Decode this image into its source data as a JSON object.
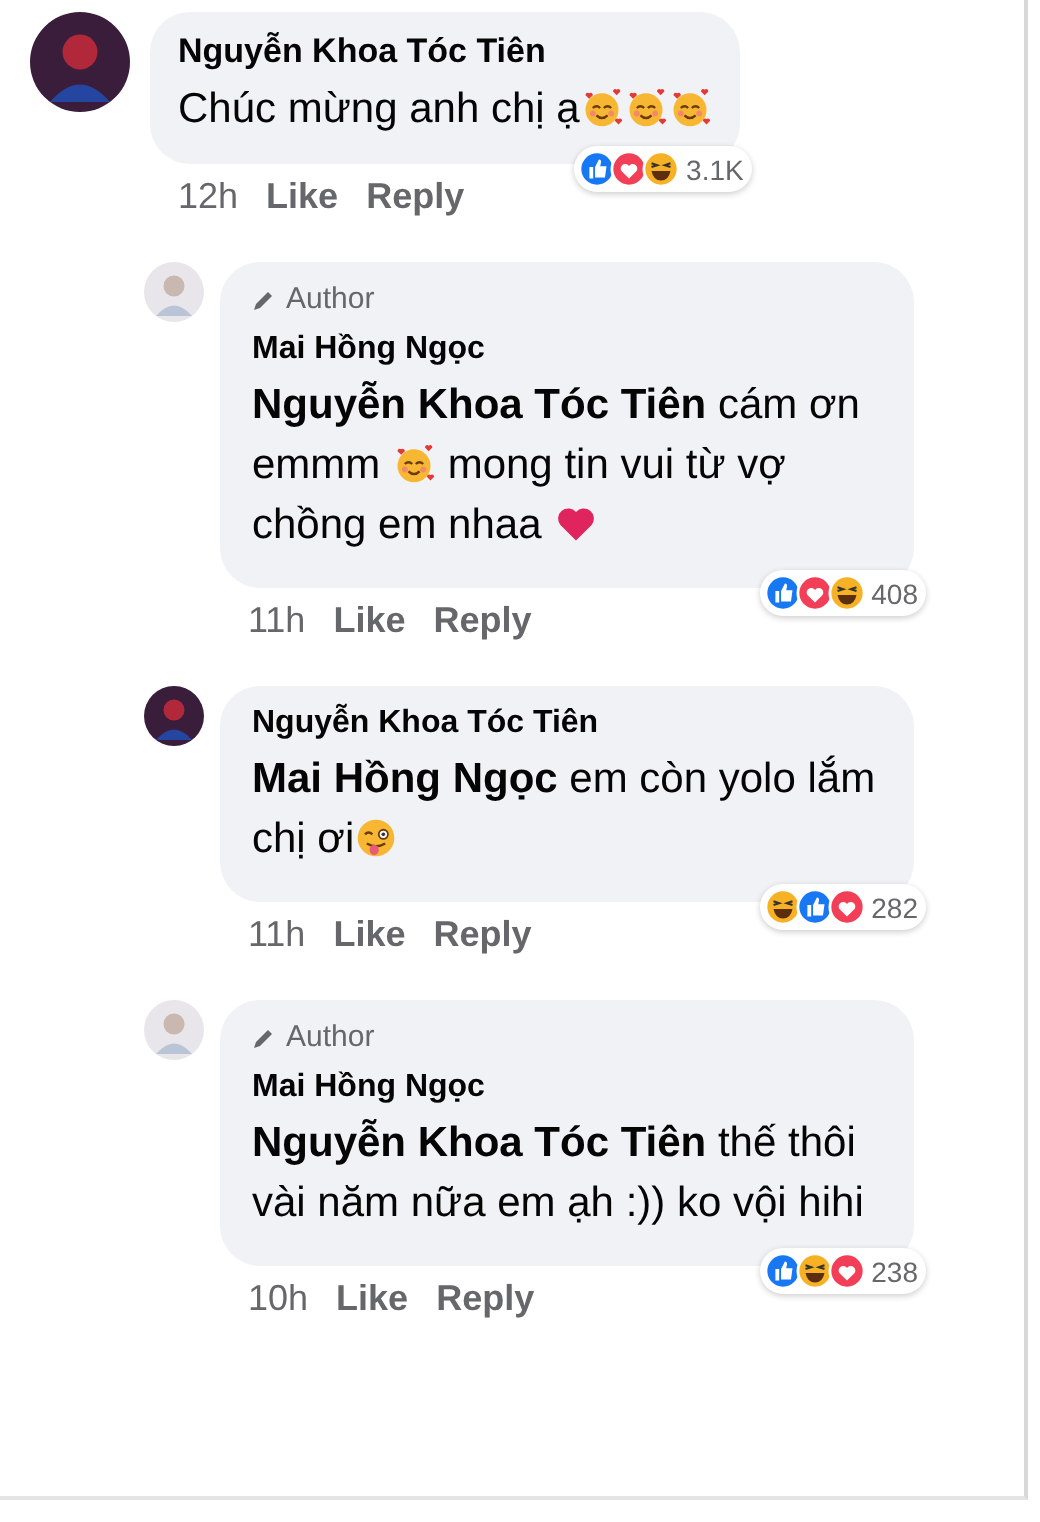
{
  "comments": [
    {
      "author": "Nguyễn Khoa Tóc Tiên",
      "reply": false,
      "is_author": false,
      "body": [
        {
          "kind": "text",
          "text": "Chúc mừng anh chị ạ"
        },
        {
          "kind": "hearts"
        },
        {
          "kind": "hearts"
        },
        {
          "kind": "hearts"
        }
      ],
      "time": "12h",
      "like": "Like",
      "reply_label": "Reply",
      "reactions": [
        {
          "kind": "like"
        },
        {
          "kind": "love"
        },
        {
          "kind": "haha"
        }
      ],
      "reaction_count": "3.1K"
    },
    {
      "author": "Mai Hồng Ngọc",
      "reply": true,
      "is_author": true,
      "author_badge": "Author",
      "body": [
        {
          "kind": "mention",
          "text": "Nguyễn Khoa Tóc Tiên"
        },
        {
          "kind": "text",
          "text": " cám ơn emmm "
        },
        {
          "kind": "hearts"
        },
        {
          "kind": "text",
          "text": " mong tin vui từ vợ chồng em nhaa "
        },
        {
          "kind": "heart"
        }
      ],
      "time": "11h",
      "like": "Like",
      "reply_label": "Reply",
      "reactions": [
        {
          "kind": "like"
        },
        {
          "kind": "love"
        },
        {
          "kind": "haha"
        }
      ],
      "reaction_count": "408"
    },
    {
      "author": "Nguyễn Khoa Tóc Tiên",
      "reply": true,
      "is_author": false,
      "body": [
        {
          "kind": "mention",
          "text": "Mai Hồng Ngọc"
        },
        {
          "kind": "text",
          "text": "  em còn yolo lắm chị ơi"
        },
        {
          "kind": "wink"
        }
      ],
      "time": "11h",
      "like": "Like",
      "reply_label": "Reply",
      "reactions": [
        {
          "kind": "haha"
        },
        {
          "kind": "like"
        },
        {
          "kind": "love"
        }
      ],
      "reaction_count": "282"
    },
    {
      "author": "Mai Hồng Ngọc",
      "reply": true,
      "is_author": true,
      "author_badge": "Author",
      "body": [
        {
          "kind": "mention",
          "text": "Nguyễn Khoa Tóc Tiên"
        },
        {
          "kind": "text",
          "text": " thế thôi vài năm nữa em ạh :)) ko vội hihi"
        }
      ],
      "time": "10h",
      "like": "Like",
      "reply_label": "Reply",
      "reactions": [
        {
          "kind": "like"
        },
        {
          "kind": "haha"
        },
        {
          "kind": "love"
        }
      ],
      "reaction_count": "238"
    }
  ]
}
